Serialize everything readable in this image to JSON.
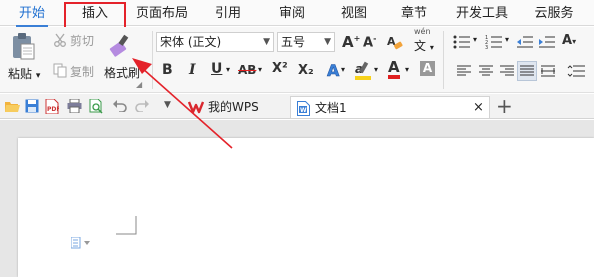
{
  "menu": {
    "tabs": [
      "开始",
      "插入",
      "页面布局",
      "引用",
      "审阅",
      "视图",
      "章节",
      "开发工具",
      "云服务"
    ],
    "active_tab": "开始",
    "highlighted_tab": "插入"
  },
  "ribbon": {
    "paste_label": "粘贴",
    "cut_label": "剪切",
    "copy_label": "复制",
    "format_painter_label": "格式刷",
    "font_family": "宋体 (正文)",
    "font_size": "五号",
    "bold": "B",
    "italic": "I",
    "underline": "U",
    "strikethrough": "AB",
    "superscript": "X²",
    "subscript": "X₂",
    "text_effect": "A",
    "highlight": "A",
    "font_color": "A",
    "char_shading": "A",
    "grow_font": "A",
    "shrink_font": "A",
    "phonetic_guide": "文",
    "phonetic_top": "wén"
  },
  "quickbar": {
    "doc_tabs": [
      {
        "label": "我的WPS",
        "icon": "wps-logo-icon",
        "active": false
      },
      {
        "label": "文档1",
        "icon": "word-doc-icon",
        "active": true
      }
    ],
    "close_symbol": "×",
    "add_symbol": "+"
  },
  "colors": {
    "accent_blue": "#1e6fd0",
    "highlight_red": "#e4222a",
    "wps_red": "#d9272e",
    "font_color_red": "#e02020",
    "highlight_yellow": "#f7d21c"
  }
}
